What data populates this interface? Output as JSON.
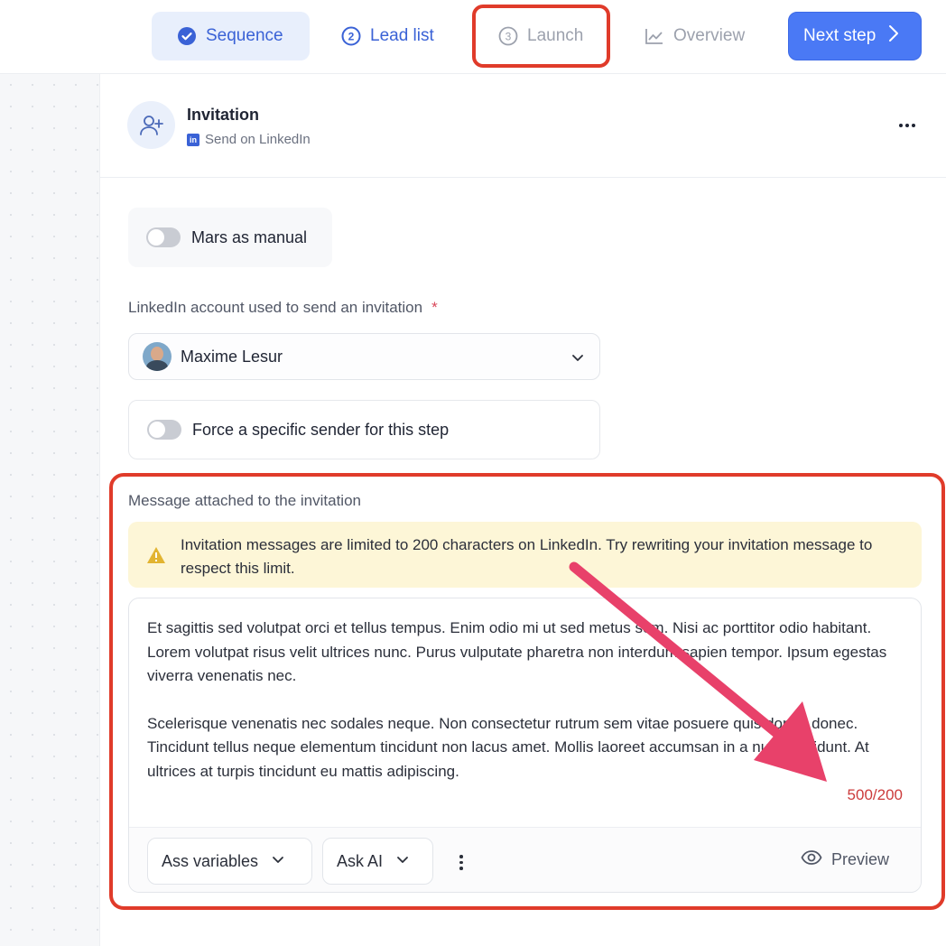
{
  "nav": {
    "steps": [
      {
        "label": "Sequence"
      },
      {
        "label": "Lead list"
      },
      {
        "label": "Launch"
      },
      {
        "label": "Overview"
      }
    ],
    "lead_number": "2",
    "launch_number": "3",
    "next_label": "Next step"
  },
  "step": {
    "title": "Invitation",
    "subtitle": "Send on LinkedIn",
    "manual_toggle_label": "Mars as manual",
    "manual_toggle_on": false
  },
  "account": {
    "label": "LinkedIn account used to send an invitation",
    "required_mark": "*",
    "selected": "Maxime Lesur"
  },
  "sender": {
    "toggle_label": "Force a specific sender for this step",
    "toggle_on": false
  },
  "message": {
    "label": "Message attached to the invitation",
    "warning": "Invitation messages are limited to 200 characters on LinkedIn. Try rewriting your invitation message to respect this limit.",
    "paragraph_1": "Et sagittis sed volutpat orci et tellus tempus. Enim odio mi ut sed metus sem. Nisi ac porttitor odio habitant. Lorem volutpat risus velit ultrices nunc. Purus vulputate pharetra non interdum sapien tempor. Ipsum egestas viverra venenatis nec.",
    "paragraph_2": "Scelerisque venenatis nec sodales neque. Non consectetur rutrum sem vitae posuere quis donec donec. Tincidunt tellus neque elementum tincidunt non lacus amet. Mollis laoreet accumsan in a nunc tincidunt. At ultrices at turpis tincidunt eu mattis adipiscing.",
    "counter": "500/200",
    "variables_label": "Ass variables",
    "ai_label": "Ask AI",
    "preview_label": "Preview"
  },
  "colors": {
    "accent": "#4a79f5",
    "highlight": "#e03b2a",
    "arrow": "#e8416a",
    "warning_bg": "#fdf6d7",
    "error_text": "#cc3b3b"
  }
}
